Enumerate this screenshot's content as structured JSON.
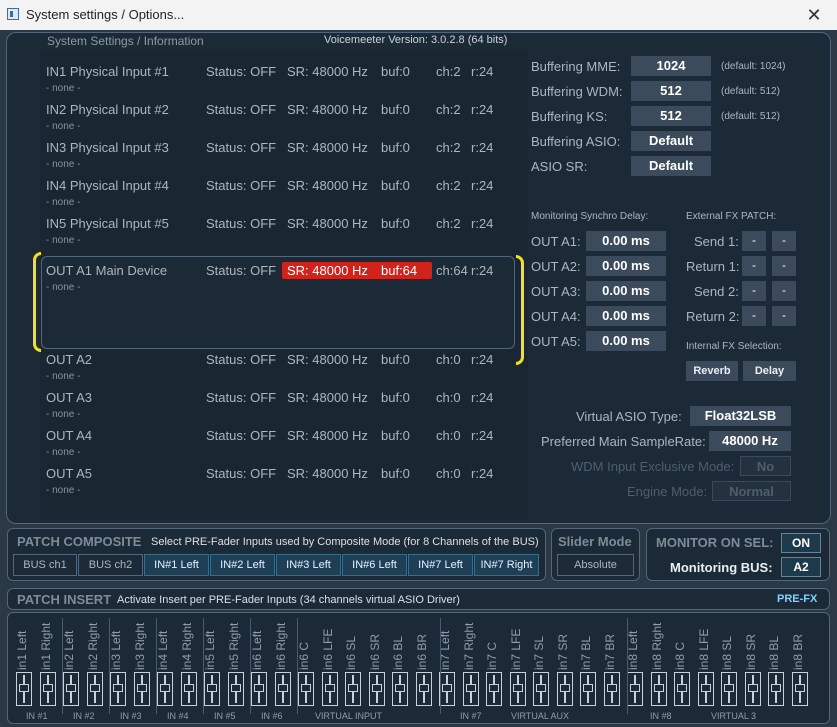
{
  "window": {
    "title": "System settings / Options...",
    "close_glyph": "✕"
  },
  "header": {
    "section": "System Settings / Information",
    "version": "Voicemeeter Version: 3.0.2.8 (64 bits)"
  },
  "devices": [
    {
      "name": "IN1 Physical Input #1",
      "sub": "- none -",
      "status": "Status: OFF",
      "sr": "SR: 48000 Hz",
      "buf": "buf:0",
      "ch": "ch:2",
      "r": "r:24"
    },
    {
      "name": "IN2 Physical Input #2",
      "sub": "- none -",
      "status": "Status: OFF",
      "sr": "SR: 48000 Hz",
      "buf": "buf:0",
      "ch": "ch:2",
      "r": "r:24"
    },
    {
      "name": "IN3 Physical Input #3",
      "sub": "- none -",
      "status": "Status: OFF",
      "sr": "SR: 48000 Hz",
      "buf": "buf:0",
      "ch": "ch:2",
      "r": "r:24"
    },
    {
      "name": "IN4 Physical Input #4",
      "sub": "- none -",
      "status": "Status: OFF",
      "sr": "SR: 48000 Hz",
      "buf": "buf:0",
      "ch": "ch:2",
      "r": "r:24"
    },
    {
      "name": "IN5 Physical Input #5",
      "sub": "- none -",
      "status": "Status: OFF",
      "sr": "SR: 48000 Hz",
      "buf": "buf:0",
      "ch": "ch:2",
      "r": "r:24"
    },
    {
      "name": "OUT A1 Main Device",
      "sub": "- none -",
      "status": "Status: OFF",
      "sr": "SR: 48000 Hz",
      "buf": "buf:64",
      "ch": "ch:64",
      "r": "r:24"
    },
    {
      "name": "OUT A2",
      "sub": "- none -",
      "status": "Status: OFF",
      "sr": "SR: 48000 Hz",
      "buf": "buf:0",
      "ch": "ch:0",
      "r": "r:24"
    },
    {
      "name": "OUT A3",
      "sub": "- none -",
      "status": "Status: OFF",
      "sr": "SR: 48000 Hz",
      "buf": "buf:0",
      "ch": "ch:0",
      "r": "r:24"
    },
    {
      "name": "OUT A4",
      "sub": "- none -",
      "status": "Status: OFF",
      "sr": "SR: 48000 Hz",
      "buf": "buf:0",
      "ch": "ch:0",
      "r": "r:24"
    },
    {
      "name": "OUT A5",
      "sub": "- none -",
      "status": "Status: OFF",
      "sr": "SR: 48000 Hz",
      "buf": "buf:0",
      "ch": "ch:0",
      "r": "r:24"
    }
  ],
  "buffering": [
    {
      "label": "Buffering MME:",
      "value": "1024",
      "default": "(default: 1024)"
    },
    {
      "label": "Buffering WDM:",
      "value": "512",
      "default": "(default: 512)"
    },
    {
      "label": "Buffering KS:",
      "value": "512",
      "default": "(default: 512)"
    },
    {
      "label": "Buffering ASIO:",
      "value": "Default"
    },
    {
      "label": "ASIO SR:",
      "value": "Default"
    }
  ],
  "monitoring": {
    "title": "Monitoring Synchro Delay:",
    "rows": [
      {
        "label": "OUT A1:",
        "value": "0.00 ms"
      },
      {
        "label": "OUT A2:",
        "value": "0.00 ms"
      },
      {
        "label": "OUT A3:",
        "value": "0.00 ms"
      },
      {
        "label": "OUT A4:",
        "value": "0.00 ms"
      },
      {
        "label": "OUT A5:",
        "value": "0.00 ms"
      }
    ]
  },
  "fx_patch": {
    "title": "External FX PATCH:",
    "rows": [
      {
        "label": "Send 1:"
      },
      {
        "label": "Return 1:"
      },
      {
        "label": "Send 2:"
      },
      {
        "label": "Return 2:"
      }
    ],
    "btn": "-"
  },
  "internal_fx": {
    "title": "Internal FX Selection:",
    "reverb": "Reverb",
    "delay": "Delay"
  },
  "asio": {
    "type_label": "Virtual ASIO Type:",
    "type_value": "Float32LSB",
    "sr_label": "Preferred Main SampleRate:",
    "sr_value": "48000 Hz"
  },
  "wdm": {
    "label": "WDM Input Exclusive Mode:",
    "value": "No"
  },
  "engine": {
    "label": "Engine Mode:",
    "value": "Normal"
  },
  "composite": {
    "title": "PATCH COMPOSITE",
    "desc": "Select PRE-Fader Inputs used by Composite Mode (for 8 Channels of the BUS)",
    "buttons": [
      "BUS ch1",
      "BUS ch2",
      "IN#1 Left",
      "IN#2 Left",
      "IN#3 Left",
      "IN#6 Left",
      "IN#7 Left",
      "IN#7 Right"
    ]
  },
  "slider": {
    "title": "Slider Mode",
    "value": "Absolute"
  },
  "monitor": {
    "title": "MONITOR ON SEL:",
    "on": "ON",
    "bus_label": "Monitoring BUS:",
    "bus": "A2"
  },
  "insert": {
    "title": "PATCH INSERT",
    "desc": "Activate Insert per PRE-Fader Inputs (34 channels virtual ASIO Driver)",
    "prefx": "PRE-FX",
    "channels": [
      "in1 Left",
      "in1 Right",
      "in2 Left",
      "in2 Right",
      "in3 Left",
      "in3 Right",
      "in4 Left",
      "in4 Right",
      "in5 Left",
      "in5 Right",
      "in6 Left",
      "in6 Right",
      "in6 C",
      "in6 LFE",
      "in6 SL",
      "in6 SR",
      "in6 BL",
      "in6 BR",
      "in7 Left",
      "in7 Right",
      "in7 C",
      "in7 LFE",
      "in7 SL",
      "in7 SR",
      "in7 BL",
      "in7 BR",
      "in8 Left",
      "in8 Right",
      "in8 C",
      "in8 LFE",
      "in8 SL",
      "in8 SR",
      "in8 BL",
      "in8 BR"
    ],
    "groups": [
      "IN #1",
      "IN #2",
      "IN #3",
      "IN #4",
      "IN #5",
      "IN #6",
      "VIRTUAL INPUT",
      "IN #7",
      "VIRTUAL AUX",
      "IN #8",
      "VIRTUAL 3"
    ]
  },
  "colors": {
    "background": "#2b3846",
    "panel": "#1c2a37",
    "highlight_red": "#d0231c",
    "annotation_yellow": "#f6df1c",
    "button_on": "#1e3f55"
  }
}
